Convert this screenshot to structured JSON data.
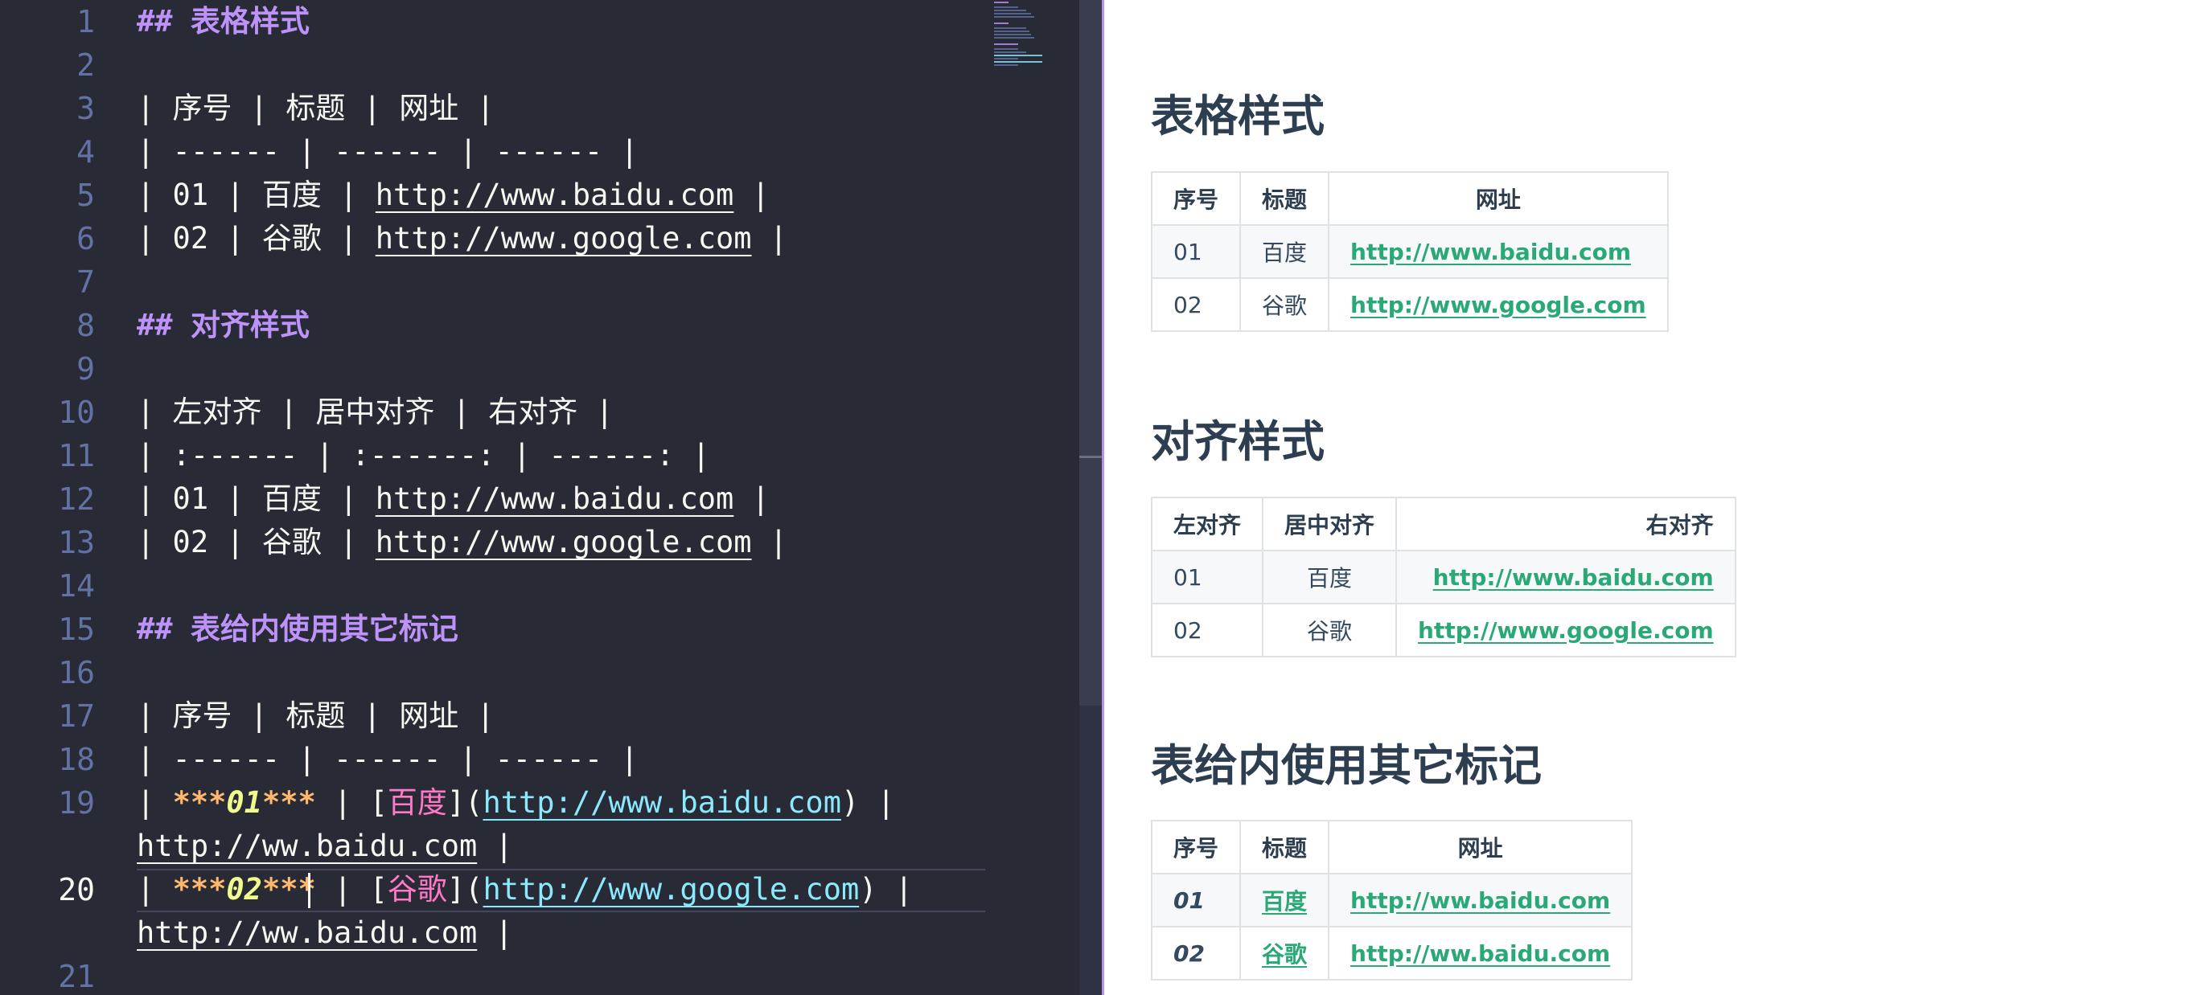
{
  "editor": {
    "line_numbers": [
      "1",
      "2",
      "3",
      "4",
      "5",
      "6",
      "7",
      "8",
      "9",
      "10",
      "11",
      "12",
      "13",
      "14",
      "15",
      "16",
      "17",
      "18",
      "19",
      "20",
      "21"
    ],
    "lines": {
      "l1": "## 表格样式",
      "l3": "| 序号 | 标题 | 网址 |",
      "l4": "| ------ | ------ | ------ |",
      "l5_pre": "| 01 | 百度 | ",
      "l5_url": "http://www.baidu.com",
      "l5_post": " |",
      "l6_pre": "| 02 | 谷歌 | ",
      "l6_url": "http://www.google.com",
      "l6_post": " |",
      "l8": "## 对齐样式",
      "l10": "| 左对齐 | 居中对齐 | 右对齐 |",
      "l11": "| :------ | :------: | ------: |",
      "l12_pre": "| 01 | 百度 | ",
      "l12_url": "http://www.baidu.com",
      "l12_post": " |",
      "l13_pre": "| 02 | 谷歌 | ",
      "l13_url": "http://www.google.com",
      "l13_post": " |",
      "l15": "## 表给内使用其它标记",
      "l17": "| 序号 | 标题 | 网址 |",
      "l18": "| ------ | ------ | ------ |",
      "l19_a": "| ",
      "l19_mark1": "***",
      "l19_em": "01",
      "l19_mark2": "***",
      "l19_b": " | [",
      "l19_link": "百度",
      "l19_c": "](",
      "l19_url": "http://www.baidu.com",
      "l19_d": ") |",
      "l19_wrap_url": "http://ww.baidu.com",
      "l19_wrap_post": " |",
      "l20_a": "| ",
      "l20_mark1": "***",
      "l20_em": "02",
      "l20_mark2": "***",
      "l20_b": " | [",
      "l20_link": "谷歌",
      "l20_c": "](",
      "l20_url": "http://www.google.com",
      "l20_d": ") |",
      "l20_wrap_url": "http://ww.baidu.com",
      "l20_wrap_post": " |"
    }
  },
  "preview": {
    "section1": {
      "title": "表格样式",
      "headers": [
        "序号",
        "标题",
        "网址"
      ],
      "rows": [
        {
          "num": "01",
          "title": "百度",
          "url": "http://www.baidu.com"
        },
        {
          "num": "02",
          "title": "谷歌",
          "url": "http://www.google.com"
        }
      ]
    },
    "section2": {
      "title": "对齐样式",
      "headers": [
        "左对齐",
        "居中对齐",
        "右对齐"
      ],
      "rows": [
        {
          "num": "01",
          "title": "百度",
          "url": "http://www.baidu.com"
        },
        {
          "num": "02",
          "title": "谷歌",
          "url": "http://www.google.com"
        }
      ]
    },
    "section3": {
      "title": "表给内使用其它标记",
      "headers": [
        "序号",
        "标题",
        "网址"
      ],
      "rows": [
        {
          "num": "01",
          "title": "百度",
          "url": "http://ww.baidu.com"
        },
        {
          "num": "02",
          "title": "谷歌",
          "url": "http://ww.baidu.com"
        }
      ]
    }
  },
  "colors": {
    "editor_bg": "#282a36",
    "heading": "#bd93f9",
    "link_text": "#ff79c6",
    "url": "#8be9fd",
    "emphasis": "#f1fa8c",
    "preview_link": "#2aa876",
    "preview_heading": "#2c3e50"
  }
}
